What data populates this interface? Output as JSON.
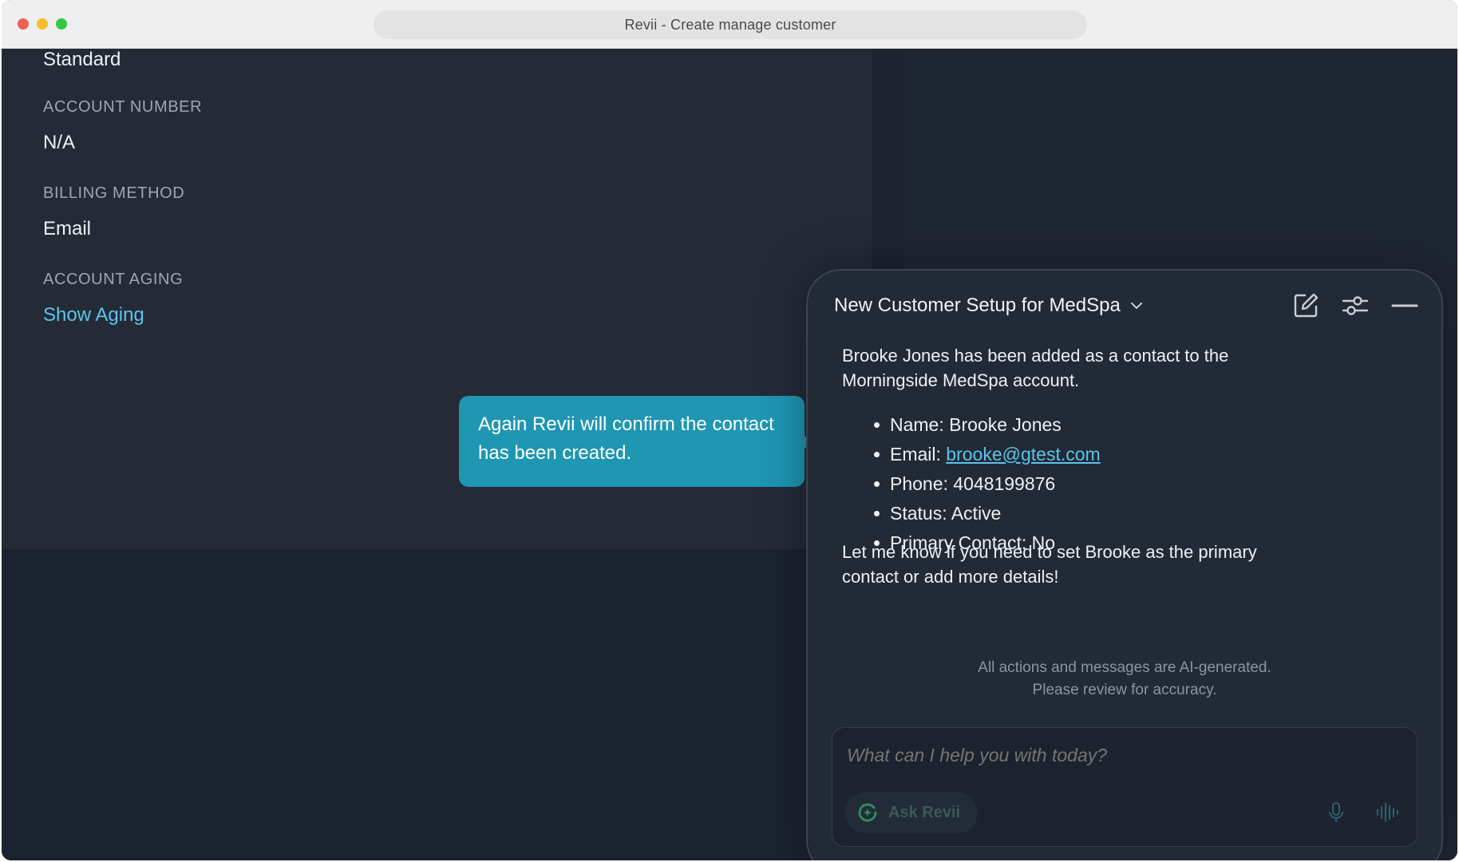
{
  "window": {
    "title": "Revii - Create manage customer"
  },
  "account": {
    "tier_value": "Standard",
    "account_number_label": "ACCOUNT NUMBER",
    "account_number_value": "N/A",
    "billing_method_label": "BILLING METHOD",
    "billing_method_value": "Email",
    "account_aging_label": "ACCOUNT AGING",
    "show_aging_link": "Show Aging"
  },
  "tooltip": {
    "text": "Again Revii will confirm the contact has been created."
  },
  "chat": {
    "title": "New Customer Setup for MedSpa",
    "intro": "Brooke Jones has been added as a contact to the Morningside MedSpa account.",
    "details": {
      "name": "Name: Brooke Jones",
      "email_label": "Email: ",
      "email_value": "brooke@gtest.com",
      "phone": "Phone: 4048199876",
      "status": "Status: Active",
      "primary": "Primary Contact: No"
    },
    "followup": "Let me know if you need to set Brooke as the primary contact or add more details!",
    "disclaimer_line1": "All actions and messages are AI-generated.",
    "disclaimer_line2": "Please review for accuracy.",
    "input_placeholder": "What can I help you with today?",
    "ask_button": "Ask Revii"
  },
  "colors": {
    "accent": "#1f96b2",
    "link": "#5cc4ea",
    "panel": "#242b37",
    "background": "#1b2330"
  },
  "icons": [
    "chevron-down-icon",
    "new-chat-icon",
    "settings-sliders-icon",
    "minimize-icon",
    "revii-logo-icon",
    "microphone-icon",
    "voice-wave-icon"
  ]
}
